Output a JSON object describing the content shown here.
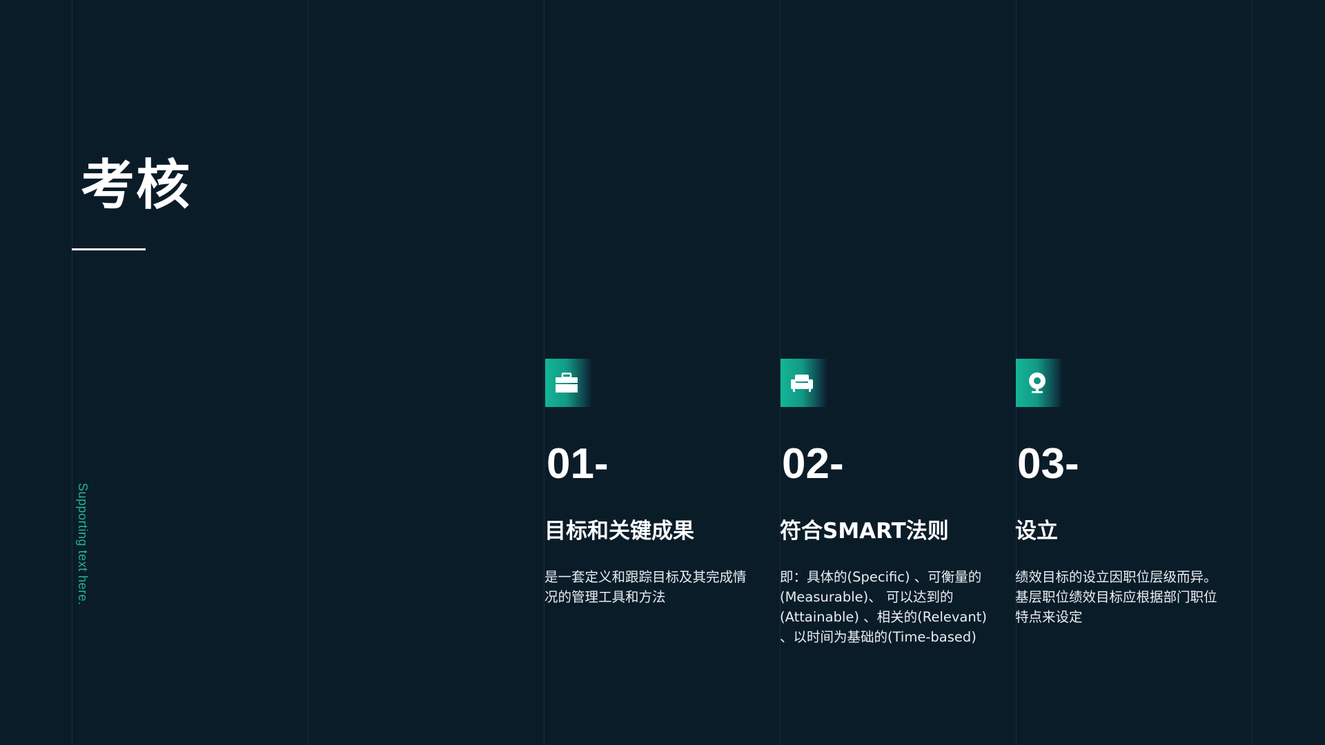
{
  "slide": {
    "title": "考核",
    "supporting_text": "Supporting text here.",
    "accent_color": "#1fb59a",
    "background_color": "#0b1c29"
  },
  "items": [
    {
      "number": "01-",
      "icon": "briefcase-icon",
      "heading": "目标和关键成果",
      "description": "是一套定义和跟踪目标及其完成情况的管理工具和方法"
    },
    {
      "number": "02-",
      "icon": "sofa-icon",
      "heading": "符合SMART法则",
      "description": "即：具体的(Specific) 、可衡量的(Measurable)、 可以达到的(Attainable) 、相关的(Relevant) 、以时间为基础的(Time-based)"
    },
    {
      "number": "03-",
      "icon": "webcam-icon",
      "heading": "设立",
      "description": "绩效目标的设立因职位层级而异。基层职位绩效目标应根据部门职位特点来设定"
    }
  ]
}
